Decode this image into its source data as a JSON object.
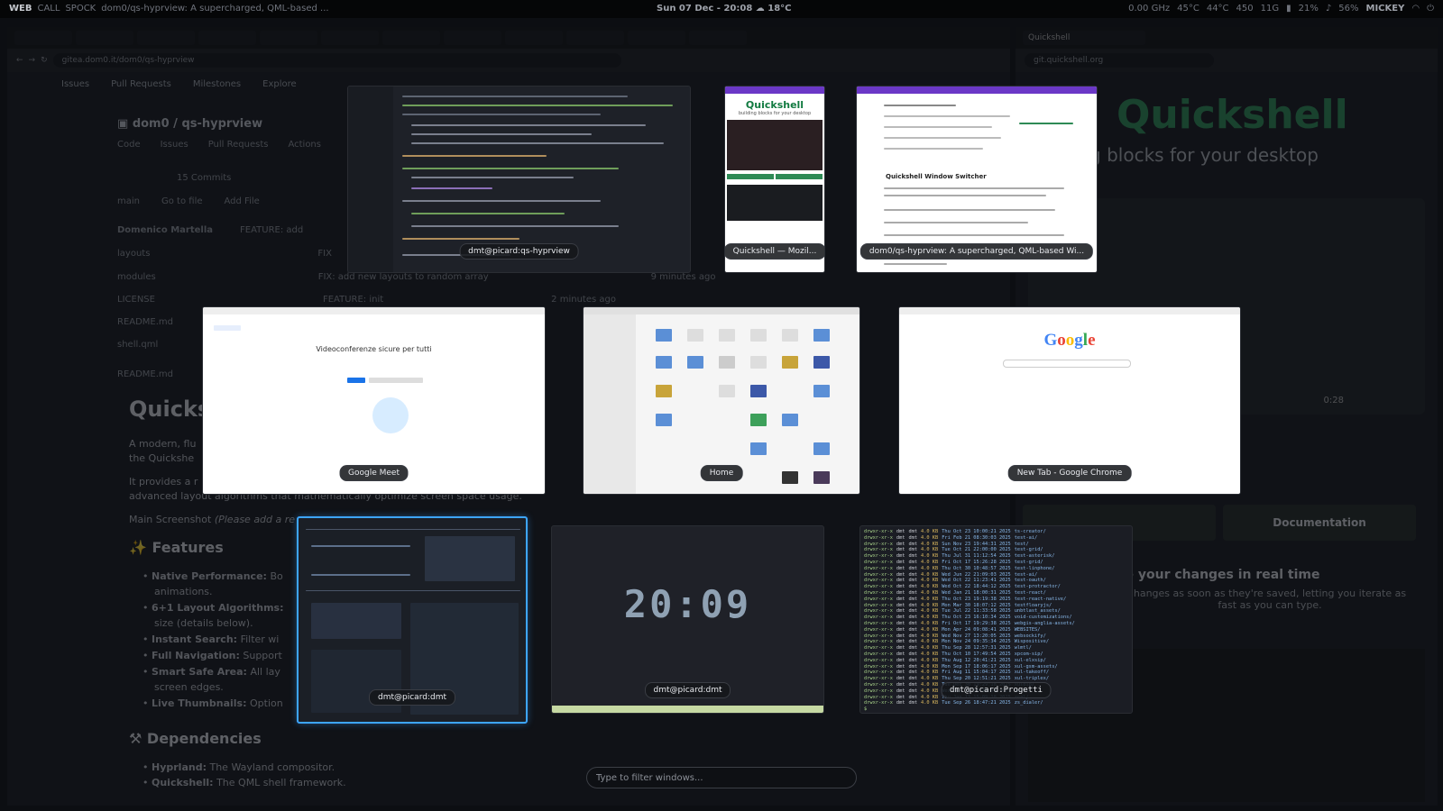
{
  "topbar": {
    "workspaces": [
      "WEB",
      "CALL",
      "SPOCK"
    ],
    "active_workspace": "WEB",
    "window_title": "dom0/qs-hyprview: A supercharged, QML-based ...",
    "datetime": "Sun 07 Dec - 20:08",
    "weather": "18°C",
    "cpu": "0.00 GHz",
    "temp1": "45°C",
    "temp2": "44°C",
    "fan": "450",
    "mem": "11G",
    "battery": "21%",
    "volume": "56%",
    "user": "MICKEY"
  },
  "background_left": {
    "url": "gitea.dom0.it/dom0/qs-hyprview",
    "nav": [
      "Issues",
      "Pull Requests",
      "Milestones",
      "Explore"
    ],
    "repo_owner": "dom0",
    "repo_name": "qs-hyprview",
    "repo_tabs": [
      "Code",
      "Issues",
      "Pull Requests",
      "Actions"
    ],
    "commits": "15 Commits",
    "branch": "main",
    "goto_file": "Go to file",
    "add_file": "Add File",
    "last_commit_author": "Domenico Martella",
    "last_commit_msg": "FEATURE: add",
    "files": [
      {
        "name": "layouts",
        "msg": "FIX",
        "age": "ago"
      },
      {
        "name": "modules",
        "msg": "FIX: add new layouts to random array",
        "age": "9 minutes ago"
      },
      {
        "name": "LICENSE",
        "msg": "FEATURE: init",
        "age": "2 minutes ago"
      },
      {
        "name": "README.md",
        "msg": "",
        "age": ""
      },
      {
        "name": "shell.qml",
        "msg": "",
        "age": ""
      }
    ],
    "readme_file": "README.md",
    "readme_title": "Quicks",
    "readme_intro_1": "A modern, flu",
    "readme_intro_2": "the Quickshe",
    "readme_provides": "It provides a r",
    "readme_algos": "advanced layout algorithms that mathematically optimize screen space usage.",
    "main_screenshot": "Main Screenshot",
    "main_screenshot_note": "(Please add a re",
    "features_heading": "Features",
    "features": [
      {
        "title": "Native Performance:",
        "text": "Bo"
      },
      {
        "title": "",
        "text": "animations."
      },
      {
        "title": "6+1 Layout Algorithms:",
        "text": ""
      },
      {
        "title": "",
        "text": "size (details below)."
      },
      {
        "title": "Instant Search:",
        "text": "Filter wi"
      },
      {
        "title": "Full Navigation:",
        "text": "Support"
      },
      {
        "title": "Smart Safe Area:",
        "text": "All lay"
      },
      {
        "title": "",
        "text": "screen edges."
      },
      {
        "title": "Live Thumbnails:",
        "text": "Option"
      }
    ],
    "dependencies_heading": "Dependencies",
    "deps": [
      {
        "title": "Hyprland:",
        "text": "The Wayland compositor."
      },
      {
        "title": "Quickshell:",
        "text": "The QML shell framework."
      }
    ]
  },
  "background_right": {
    "url": "git.quickshell.org",
    "tab": "Quickshell",
    "logo": "Quickshell",
    "subtitle": "ilding blocks for your desktop",
    "video_time": "0:28",
    "doc_button": "Documentation",
    "h2": "ee your changes in real time",
    "p": "hanges as soon as they're saved, letting you iterate as fast as you can type."
  },
  "windows": [
    {
      "id": "editor",
      "label": "dmt@picard:qs-hyprview"
    },
    {
      "id": "moz",
      "label": "Quickshell — Mozil...",
      "logo": "Quickshell",
      "sub": "building blocks for your desktop"
    },
    {
      "id": "git",
      "label": "dom0/qs-hyprview: A supercharged, QML-based Wi...",
      "title": "Quickshell Window Switcher"
    },
    {
      "id": "meet",
      "label": "Google Meet",
      "headline": "Videoconferenze sicure per tutti"
    },
    {
      "id": "files",
      "label": "Home"
    },
    {
      "id": "chrome",
      "label": "New Tab - Google Chrome",
      "logo": "Google"
    },
    {
      "id": "btop",
      "label": "dmt@picard:dmt"
    },
    {
      "id": "clock",
      "label": "dmt@picard:dmt",
      "time": "20:09"
    },
    {
      "id": "term",
      "label": "dmt@picard:Progetti"
    }
  ],
  "terminal_rows": [
    {
      "mode": "drwxr-xr-x",
      "date": "Thu Oct 23 10:00:21 2025",
      "name": "ts-creator/"
    },
    {
      "mode": "drwxr-xr-x",
      "date": "Fri Feb 21 08:30:03 2025",
      "name": "test-ai/"
    },
    {
      "mode": "drwxr-xr-x",
      "date": "Sun Nov 23 19:44:31 2025",
      "name": "test/"
    },
    {
      "mode": "drwxr-xr-x",
      "date": "Tue Oct 21 22:00:00 2025",
      "name": "test-grid/"
    },
    {
      "mode": "drwxr-xr-x",
      "date": "Thu Jul 31 11:12:54 2025",
      "name": "test-asterisk/"
    },
    {
      "mode": "drwxr-xr-x",
      "date": "Fri Oct 17 15:26:28 2025",
      "name": "test-grid/"
    },
    {
      "mode": "drwxr-xr-x",
      "date": "Thu Oct 30 10:48:57 2025",
      "name": "test-linphone/"
    },
    {
      "mode": "drwxr-xr-x",
      "date": "Wed Jun 22 21:09:03 2025",
      "name": "test-ai/"
    },
    {
      "mode": "drwxr-xr-x",
      "date": "Wed Oct 22 11:23:41 2025",
      "name": "test-oauth/"
    },
    {
      "mode": "drwxr-xr-x",
      "date": "Wed Oct 22 18:44:12 2025",
      "name": "test-protractor/"
    },
    {
      "mode": "drwxr-xr-x",
      "date": "Wed Jan 21 18:00:31 2025",
      "name": "test-react/"
    },
    {
      "mode": "drwxr-xr-x",
      "date": "Thu Oct 23 19:19:38 2025",
      "name": "test-react-native/"
    },
    {
      "mode": "drwxr-xr-x",
      "date": "Mon Mar 30 18:07:12 2025",
      "name": "testfloaryjs/"
    },
    {
      "mode": "drwxr-xr-x",
      "date": "Tue Jul 22 11:33:58 2025",
      "name": "unbtlast_assets/"
    },
    {
      "mode": "drwxr-xr-x",
      "date": "Thu Oct 23 16:10:34 2025",
      "name": "void-customizations/"
    },
    {
      "mode": "drwxr-xr-x",
      "date": "Fri Oct 17 19:29:38 2025",
      "name": "webgis-anglia-assets/"
    },
    {
      "mode": "drwxr-xr-x",
      "date": "Mon Apr 24 09:08:41 2025",
      "name": "WEBSITES/"
    },
    {
      "mode": "drwxr-xr-x",
      "date": "Wed Nov 27 13:20:05 2025",
      "name": "websockify/"
    },
    {
      "mode": "drwxr-xr-x",
      "date": "Mon Nov 24 09:35:34 2025",
      "name": "Wispositive/"
    },
    {
      "mode": "drwxr-xr-x",
      "date": "Thu Sep 28 12:57:31 2025",
      "name": "wlmtl/"
    },
    {
      "mode": "drwxr-xr-x",
      "date": "Thu Oct 10 17:49:54 2025",
      "name": "xpcom-sip/"
    },
    {
      "mode": "drwxr-xr-x",
      "date": "Thu Aug 12 20:41:21 2025",
      "name": "xul-elxsip/"
    },
    {
      "mode": "drwxr-xr-x",
      "date": "Mon Sep 17 18:06:17 2025",
      "name": "xul-gsm-assets/"
    },
    {
      "mode": "drwxr-xr-x",
      "date": "Fri Aug 11 15:04:17 2025",
      "name": "xul-takeoff/"
    },
    {
      "mode": "drwxr-xr-x",
      "date": "Thu Sep 20 12:51:21 2025",
      "name": "xul-triplex/"
    },
    {
      "mode": "drwxr-xr-x",
      "date": "Tue Dec 30 19:29:18 2025",
      "name": "xuldip/"
    },
    {
      "mode": "drwxr-xr-x",
      "date": "Wed Dec 11 13:41:38 2025",
      "name": "xulix/"
    },
    {
      "mode": "drwxr-xr-x",
      "date": "Thu Jan 13 15:09:18 2025",
      "name": "zeal/"
    },
    {
      "mode": "drwxr-xr-x",
      "date": "Tue Sep 26 18:47:21 2025",
      "name": "zs_dialer/"
    }
  ],
  "terminal_meta": {
    "user": "dmt",
    "size": "4.0",
    "unit": "KB",
    "prompt": "$ "
  },
  "search": {
    "placeholder": "Type to filter windows..."
  },
  "colors": {
    "selected_border": "#3da5ff",
    "background": "#0c0e12",
    "label_bg": "#15171b"
  }
}
